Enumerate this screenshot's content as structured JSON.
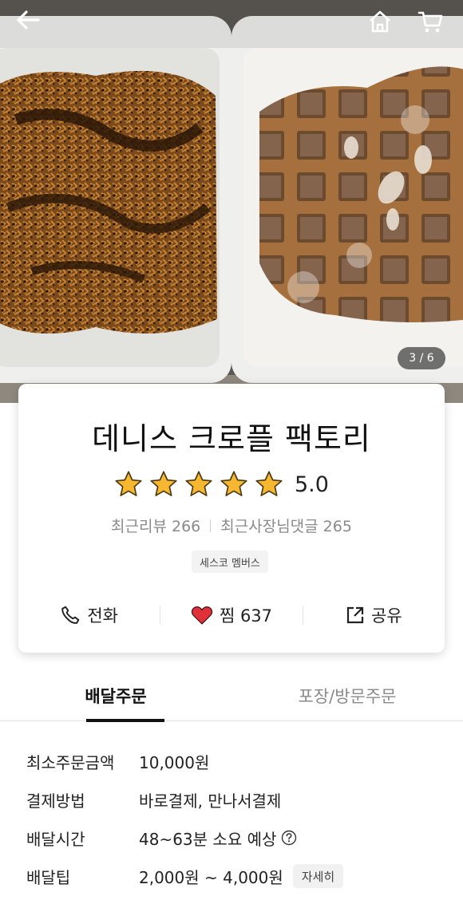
{
  "hero": {
    "image_counter": "3 / 6",
    "icons": {
      "back": "back-arrow-icon",
      "home": "home-icon",
      "cart": "cart-icon"
    }
  },
  "store": {
    "name": "데니스 크로플 팩토리",
    "rating": {
      "value": "5.0",
      "stars": 5,
      "star_color": "#f7b731"
    },
    "recent_reviews": "최근리뷰 266",
    "recent_owner_replies": "최근사장님댓글 265",
    "member_badge": "세스코 멤버스"
  },
  "actions": {
    "call": "전화",
    "like": "찜 637",
    "share": "공유",
    "heart_color": "#e0313b"
  },
  "tabs": [
    {
      "label": "배달주문",
      "active": true
    },
    {
      "label": "포장/방문주문",
      "active": false
    }
  ],
  "info": {
    "min_order": {
      "label": "최소주문금액",
      "value": "10,000원"
    },
    "payment": {
      "label": "결제방법",
      "value": "바로결제, 만나서결제"
    },
    "delivery_time": {
      "label": "배달시간",
      "value": "48~63분 소요 예상"
    },
    "delivery_tip": {
      "label": "배달팁",
      "value": "2,000원 ~ 4,000원",
      "detail_button": "자세히"
    }
  }
}
